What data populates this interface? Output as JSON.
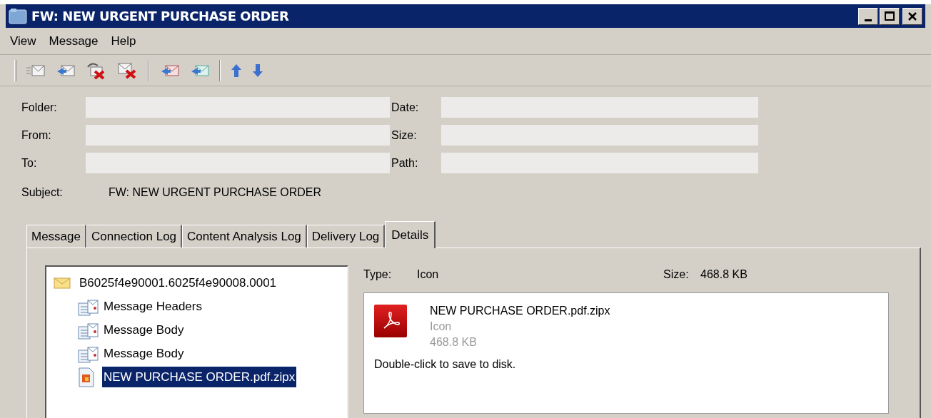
{
  "window": {
    "title": "FW: NEW URGENT PURCHASE ORDER"
  },
  "menu": [
    "View",
    "Message",
    "Help"
  ],
  "header_fields": [
    {
      "label": "Folder:"
    },
    {
      "label": "Date:"
    },
    {
      "label": "From:"
    },
    {
      "label": "Size:"
    },
    {
      "label": "To:"
    },
    {
      "label": "Path:"
    }
  ],
  "subject": {
    "label": "Subject:",
    "value": "FW: NEW URGENT PURCHASE ORDER"
  },
  "tabs": [
    {
      "label": "Message",
      "selected": false
    },
    {
      "label": "Connection Log",
      "selected": false
    },
    {
      "label": "Content Analysis Log",
      "selected": false
    },
    {
      "label": "Delivery Log",
      "selected": false
    },
    {
      "label": "Details",
      "selected": true
    }
  ],
  "tree": {
    "label": "B6025f4e90001.6025f4e90008.0001",
    "kind": "envelope",
    "selected": false,
    "children": [
      {
        "label": "Message Headers",
        "kind": "part",
        "selected": false
      },
      {
        "label": "Message Body",
        "kind": "part",
        "selected": false
      },
      {
        "label": "Message Body",
        "kind": "part",
        "selected": false
      },
      {
        "label": "NEW PURCHASE ORDER.pdf.zipx",
        "kind": "file",
        "selected": true
      }
    ]
  },
  "details": {
    "type_label": "Type:",
    "type_value": "Icon",
    "size_label": "Size:",
    "size_value": "468.8 KB",
    "preview": {
      "name": "NEW PURCHASE ORDER.pdf.zipx",
      "type": "Icon",
      "size": "468.8 KB",
      "hint": "Double-click to save to disk."
    }
  }
}
